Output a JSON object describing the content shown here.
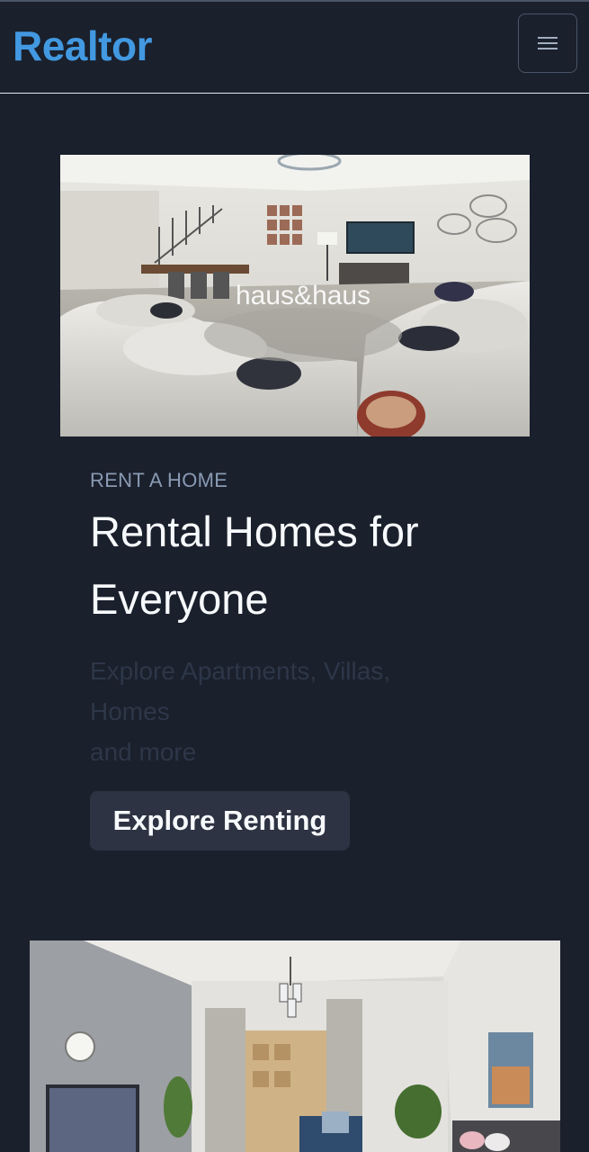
{
  "header": {
    "brand": "Realtor",
    "menu_icon": "hamburger-menu-icon"
  },
  "hero": {
    "image_watermark": "haus&haus",
    "eyebrow": "RENT A HOME",
    "headline": "Rental Homes for Everyone",
    "subtext_lines": [
      "Explore Apartments, Villas,",
      "Homes",
      "and more"
    ],
    "cta_label": "Explore Renting"
  },
  "colors": {
    "background": "#1a202c",
    "brand": "#4299e1",
    "button_bg": "#2d3342",
    "eyebrow": "#8a9ab3"
  }
}
